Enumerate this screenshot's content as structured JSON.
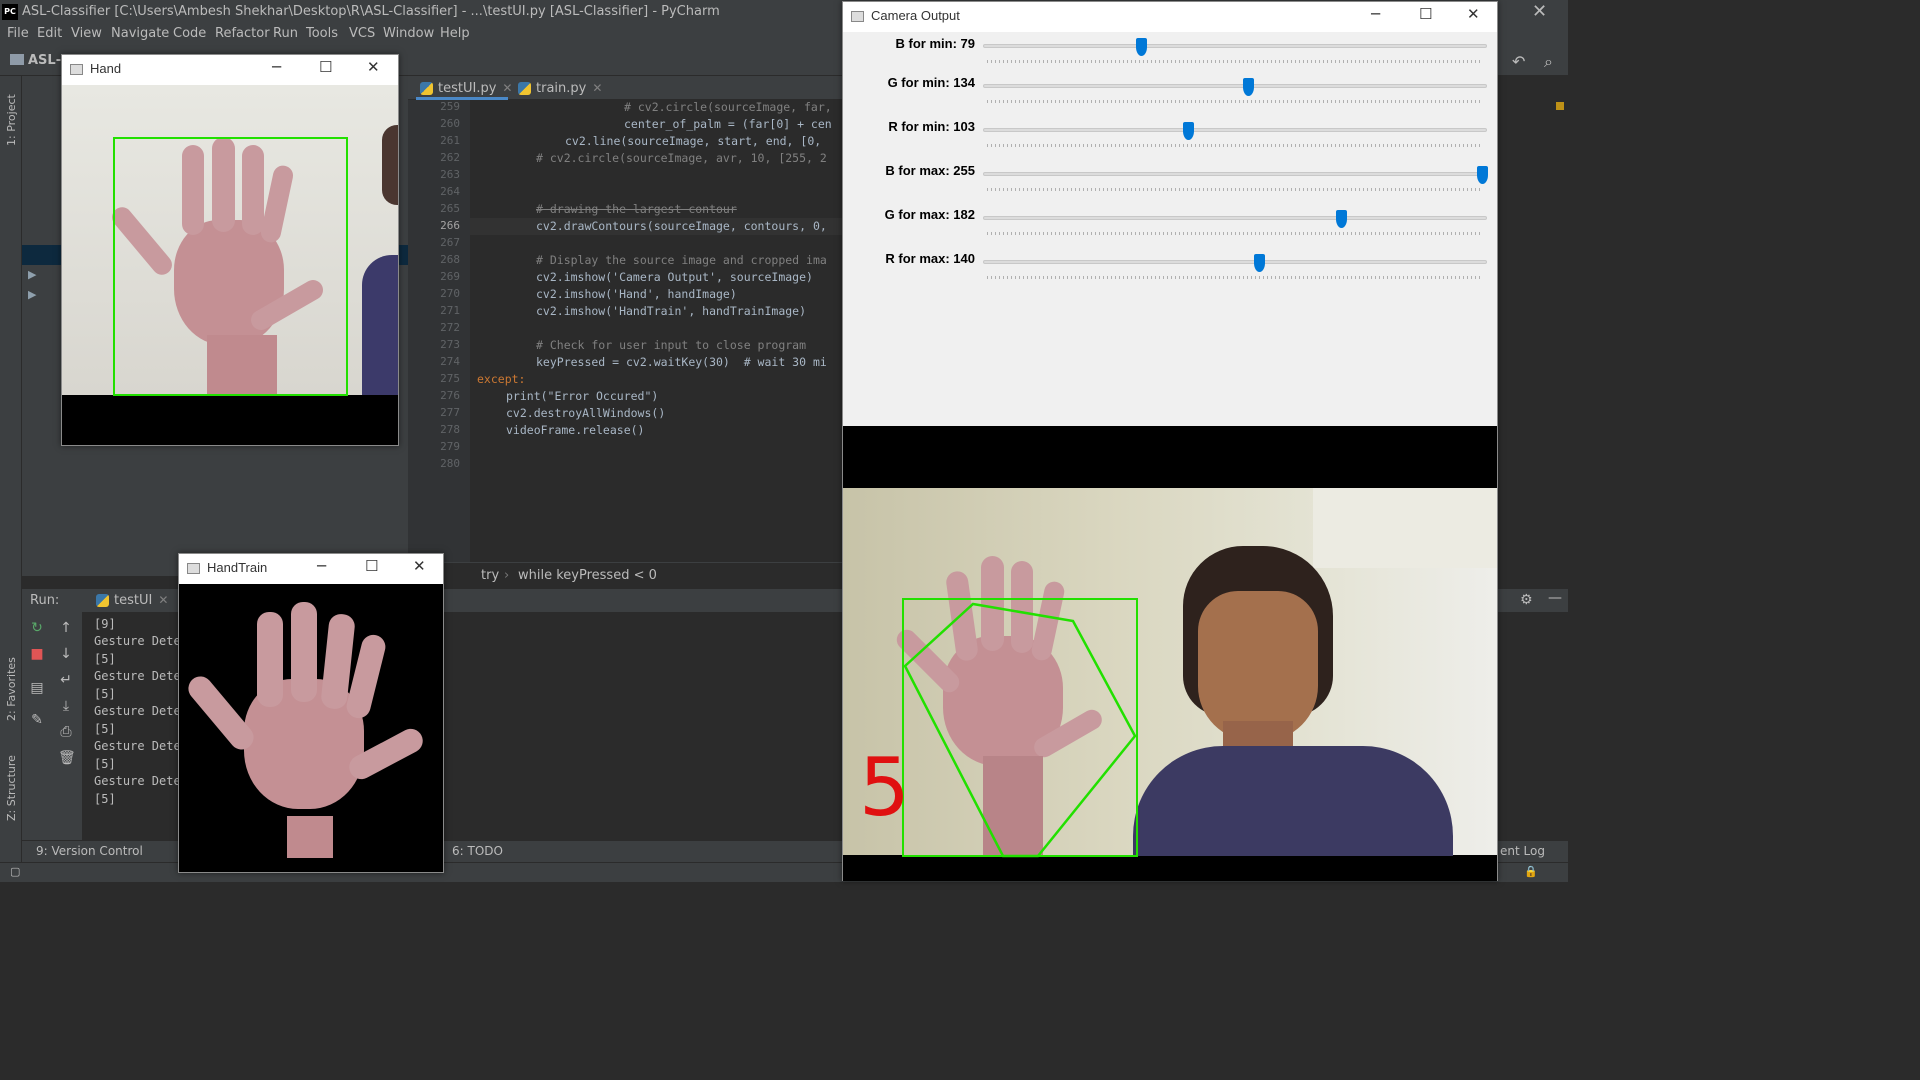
{
  "ide": {
    "title": "ASL-Classifier [C:\\Users\\Ambesh Shekhar\\Desktop\\R\\ASL-Classifier] - ...\\testUI.py [ASL-Classifier] - PyCharm",
    "menu": [
      "File",
      "Edit",
      "View",
      "Navigate",
      "Code",
      "Refactor",
      "Run",
      "Tools",
      "VCS",
      "Window",
      "Help"
    ],
    "project_name": "ASL-C",
    "left_strip": {
      "project": "1: Project",
      "favorites": "2: Favorites",
      "structure": "Z: Structure"
    },
    "tabs": [
      {
        "label": "testUI.py",
        "active": true
      },
      {
        "label": "train.py",
        "active": false
      }
    ],
    "line_numbers": [
      "259",
      "260",
      "261",
      "262",
      "263",
      "264",
      "265",
      "266",
      "267",
      "268",
      "269",
      "270",
      "271",
      "272",
      "273",
      "274",
      "275",
      "276",
      "277",
      "278",
      "279",
      "280"
    ],
    "code": [
      "# cv2.circle(sourceImage, far,",
      "center_of_palm = (far[0] + cen",
      "cv2.line(sourceImage, start, end, [0,",
      "# cv2.circle(sourceImage, avr, 10, [255, 2",
      "",
      "",
      "# drawing the largest contour",
      "cv2.drawContours(sourceImage, contours, 0,",
      "",
      "# Display the source image and cropped ima",
      "cv2.imshow('Camera Output', sourceImage)",
      "cv2.imshow('Hand', handImage)",
      "cv2.imshow('HandTrain', handTrainImage)",
      "",
      "# Check for user input to close program",
      "keyPressed = cv2.waitKey(30)  # wait 30 mi",
      "except:",
      "print(\"Error Occured\")",
      "cv2.destroyAllWindows()",
      "videoFrame.release()",
      "",
      ""
    ],
    "breadcrumb": [
      "try",
      "while keyPressed < 0"
    ],
    "run_label": "Run:",
    "run_tab": "testUI",
    "console": [
      "[9]",
      "Gesture Dete",
      "[5]",
      "Gesture Dete",
      "[5]",
      "Gesture Dete",
      "[5]",
      "Gesture Dete",
      "[5]",
      "Gesture Dete",
      "[5]"
    ],
    "status_tabs": {
      "version_control": "9: Version Control",
      "todo": "6: TODO",
      "event_log": "ent Log"
    }
  },
  "hand_window": {
    "title": "Hand"
  },
  "handtrain_window": {
    "title": "HandTrain"
  },
  "camera_window": {
    "title": "Camera Output",
    "trackbars": [
      {
        "label": "B for min: 79",
        "value": 79
      },
      {
        "label": "G for min: 134",
        "value": 134
      },
      {
        "label": "R for min: 103",
        "value": 103
      },
      {
        "label": "B for max: 255",
        "value": 255
      },
      {
        "label": "G for max: 182",
        "value": 182
      },
      {
        "label": "R for max: 140",
        "value": 140
      }
    ],
    "trackbar_max": 255,
    "gesture_digit": "5"
  },
  "colors": {
    "bbox_green": "#22e000",
    "digit_red": "#e01010",
    "slider_blue": "#0078d7"
  }
}
